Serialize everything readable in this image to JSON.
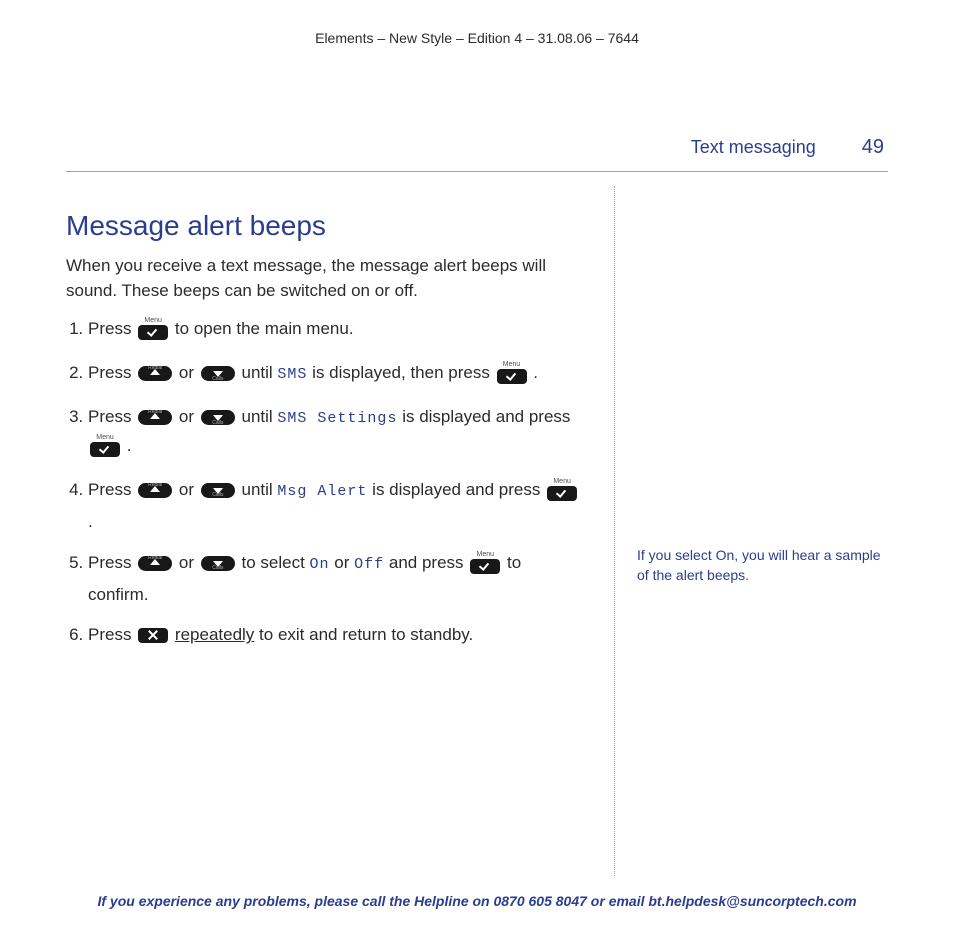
{
  "meta": {
    "top": "Elements – New Style – Edition 4 – 31.08.06 – 7644"
  },
  "header": {
    "section": "Text messaging",
    "page_number": "49"
  },
  "title": "Message alert beeps",
  "intro": "When you receive a text message, the message alert beeps will sound. These beeps can be switched on or off.",
  "steps": {
    "s1": {
      "a": "Press ",
      "b": " to open the main menu."
    },
    "s2": {
      "a": "Press ",
      "b": " or ",
      "c": " until ",
      "lcd": "SMS",
      "d": " is displayed, then press ",
      "e": "."
    },
    "s3": {
      "a": "Press ",
      "b": " or ",
      "c": " until ",
      "lcd": "SMS Settings",
      "d": " is displayed and press ",
      "e": "."
    },
    "s4": {
      "a": "Press ",
      "b": " or ",
      "c": " until ",
      "lcd": "Msg Alert",
      "d": " is displayed and press ",
      "e": "."
    },
    "s5": {
      "a": "Press ",
      "b": " or ",
      "c": " to select ",
      "lcd_on": "On",
      "mid": " or ",
      "lcd_off": "Off",
      "d": " and press ",
      "e": " to confirm."
    },
    "s6": {
      "a": "Press ",
      "b": " ",
      "repeatedly": "repeatedly",
      "c": " to exit and return to standby."
    }
  },
  "keys": {
    "menu_label": "Menu",
    "up_label": "Redial",
    "down_label": "Calls"
  },
  "side_note": "If you select On, you will hear a sample of the alert beeps.",
  "footer": "If you experience any problems, please call the Helpline on 0870 605 8047 or email bt.helpdesk@suncorptech.com"
}
